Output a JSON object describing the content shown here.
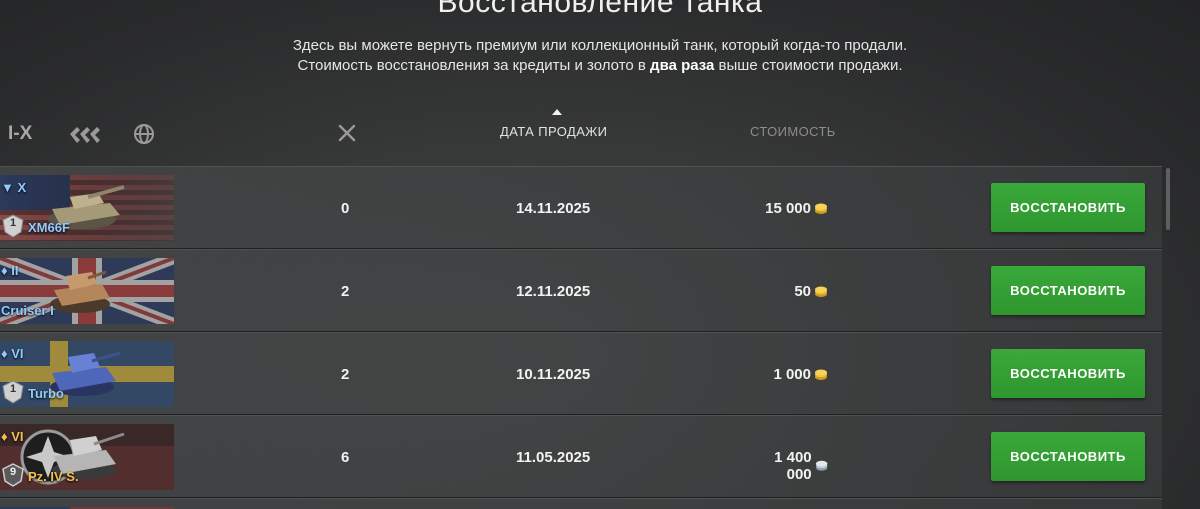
{
  "header": {
    "title": "Восстановление танка",
    "subtitle_line1": "Здесь вы можете вернуть премиум или коллекционный танк, который когда-то продали.",
    "subtitle_line2_a": "Стоимость восстановления за кредиты и золото в ",
    "subtitle_line2_bold": "два раза",
    "subtitle_line2_b": " выше стоимости продажи."
  },
  "filters": {
    "tier_label": "I-X",
    "type_icon": "vehicle-type-icon",
    "nation_icon": "globe-icon"
  },
  "columns": {
    "battles_icon": "crossed-swords-icon",
    "date_label": "ДАТА ПРОДАЖИ",
    "cost_label": "СТОИМОСТЬ"
  },
  "rows": [
    {
      "tier": "▼ X",
      "name": "XM66F",
      "mastery": "1",
      "battles": "0",
      "date": "14.11.2025",
      "price": "15 000",
      "currency": "gold-coin-icon",
      "button": "ВОССТАНОВИТЬ"
    },
    {
      "tier": "♦ II",
      "name": "Cruiser I",
      "mastery": "",
      "battles": "2",
      "date": "12.11.2025",
      "price": "50",
      "currency": "gold-coin-icon",
      "button": "ВОССТАНОВИТЬ"
    },
    {
      "tier": "♦ VI",
      "name": "Turbo",
      "mastery": "1",
      "battles": "2",
      "date": "10.11.2025",
      "price": "1 000",
      "currency": "gold-coin-icon",
      "button": "ВОССТАНОВИТЬ"
    },
    {
      "tier": "♦ VI",
      "name": "Pz. IV S.",
      "mastery": "9",
      "battles": "6",
      "date": "11.05.2025",
      "price": "1 400 000",
      "currency": "silver-coin-icon",
      "button": "ВОССТАНОВИТЬ"
    }
  ],
  "colors": {
    "button": "#2e972e",
    "premium_name": "#8ecbff",
    "collector_name": "#f2c14e"
  }
}
